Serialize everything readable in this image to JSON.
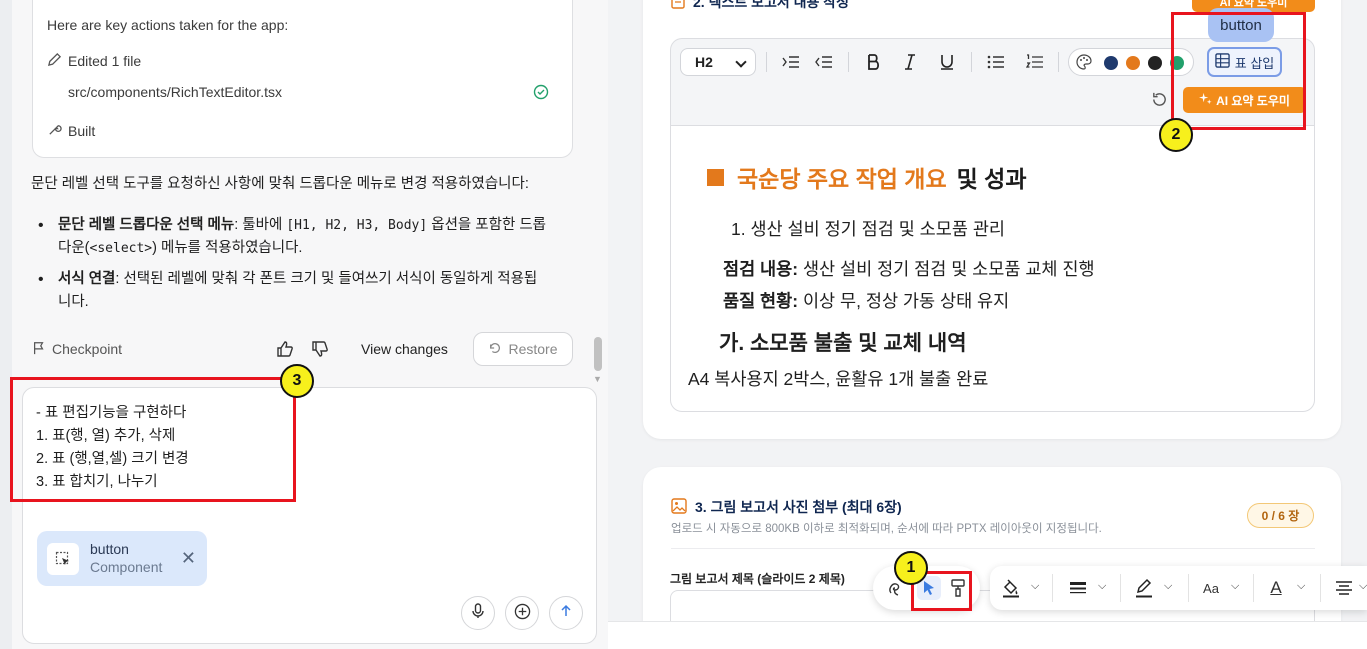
{
  "chat": {
    "card": {
      "header": "Here are key actions taken for the app:",
      "edited": "Edited 1 file",
      "file_path": "src/components/RichTextEditor.tsx",
      "built": "Built"
    },
    "message": "문단 레벨 선택 도구를 요청하신 사항에 맞춰 드롭다운 메뉴로 변경 적용하였습니다:",
    "bullets": [
      {
        "title": "문단 레벨 드롭다운 선택 메뉴",
        "text1": ": 툴바에 ",
        "code1": "[H1, H2, H3, Body]",
        "text2": " 옵션을 포함한 드롭",
        "text3": "다운(",
        "code2": "<select>",
        "text4": ") 메뉴를 적용하였습니다."
      },
      {
        "title": "서식 연결",
        "text1": ": 선택된 레벨에 맞춰 각 폰트 크기 및 들여쓰기 서식이 동일하게 적용됩",
        "text2": "니다."
      }
    ],
    "actions": {
      "checkpoint": "Checkpoint",
      "view_changes": "View changes",
      "restore": "Restore"
    },
    "input_text": "- 표 편집기능을 구현하다\n1. 표(행, 열) 추가, 삭제\n2. 표 (행,열,셀) 크기 변경\n3. 표 합치기, 나누기",
    "chip": {
      "title": "button",
      "subtitle": "Component"
    }
  },
  "editor": {
    "section2_title": "2. 텍스트 보고서 내용 작성",
    "toolbar": {
      "level_select": "H2",
      "insert_table": "표 삽입",
      "ai_assist": "AI 요약 도우미",
      "tooltip": "button",
      "colors": [
        "#1f3a6e",
        "#e3791c",
        "#222222",
        "#22a06b"
      ]
    },
    "doc": {
      "h1_orange": "국순당 주요 작업 개요",
      "h1_rest": "및 성과",
      "list_item": "1. 생산 설비 정기 점검 및 소모품 관리",
      "line1_label": "점검 내용:",
      "line1_text": " 생산 설비 정기 점검 및 소모품 교체 진행",
      "line2_label": "품질 현황:",
      "line2_text": " 이상 무, 정상 가동 상태 유지",
      "h3": "가. 소모품 불출 및 교체 내역",
      "body": "A4 복사용지 2박스, 윤활유 1개 불출 완료"
    },
    "section3": {
      "title": "3. 그림 보고서 사진 첨부 (최대 6장)",
      "badge": "0 / 6 장",
      "subtitle": "업로드 시 자동으로 800KB 이하로 최적화되며, 순서에 따라 PPTX 레이아웃이 지정됩니다.",
      "field_label": "그림 보고서 제목 (슬라이드 2 제목)"
    },
    "float_toolbar": {
      "font_size_label": "Aa",
      "font_color_label": "A"
    }
  },
  "annotations": {
    "markers": [
      "1",
      "2",
      "3"
    ],
    "color": "#e8141e"
  }
}
